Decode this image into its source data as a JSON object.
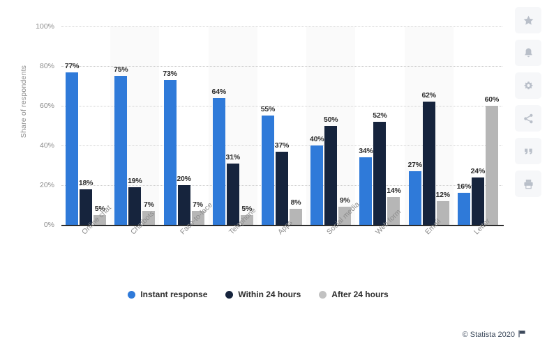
{
  "chart_data": {
    "type": "bar",
    "title": "",
    "subtitle": "",
    "xlabel": "",
    "ylabel": "Share of respondents",
    "ylim": [
      0,
      100
    ],
    "yticks": [
      "0%",
      "20%",
      "40%",
      "60%",
      "80%",
      "100%"
    ],
    "ytick_values": [
      0,
      20,
      40,
      60,
      80,
      100
    ],
    "grid": true,
    "legend_position": "bottom",
    "value_suffix": "%",
    "categories": [
      "Online chat",
      "Chatbots",
      "Face-to-face",
      "Telephone",
      "Apps",
      "Social media",
      "Web form",
      "Email",
      "Letter"
    ],
    "series": [
      {
        "name": "Instant response",
        "color": "#2f7ad9",
        "values": [
          77,
          75,
          73,
          64,
          55,
          40,
          34,
          27,
          16
        ],
        "labels": [
          "77%",
          "75%",
          "73%",
          "64%",
          "55%",
          "40%",
          "34%",
          "27%",
          "16%"
        ]
      },
      {
        "name": "Within 24 hours",
        "color": "#16243d",
        "values": [
          18,
          19,
          20,
          31,
          37,
          50,
          52,
          62,
          24
        ],
        "labels": [
          "18%",
          "19%",
          "20%",
          "31%",
          "37%",
          "50%",
          "52%",
          "62%",
          "24%"
        ]
      },
      {
        "name": "After 24 hours",
        "color": "#b6b6b6",
        "values": [
          5,
          7,
          7,
          5,
          8,
          9,
          14,
          12,
          60
        ],
        "labels": [
          "5%",
          "7%",
          "7%",
          "5%",
          "8%",
          "9%",
          "14%",
          "12%",
          "60%"
        ]
      }
    ]
  },
  "footer": {
    "copyright": "© Statista 2020",
    "flag_icon": "flag-icon"
  },
  "sidebar": {
    "items": [
      {
        "icon": "star-icon",
        "label": "Favorite"
      },
      {
        "icon": "bell-icon",
        "label": "Notifications"
      },
      {
        "icon": "gear-icon",
        "label": "Settings"
      },
      {
        "icon": "share-icon",
        "label": "Share"
      },
      {
        "icon": "quote-icon",
        "label": "Citation"
      },
      {
        "icon": "print-icon",
        "label": "Print"
      }
    ]
  }
}
